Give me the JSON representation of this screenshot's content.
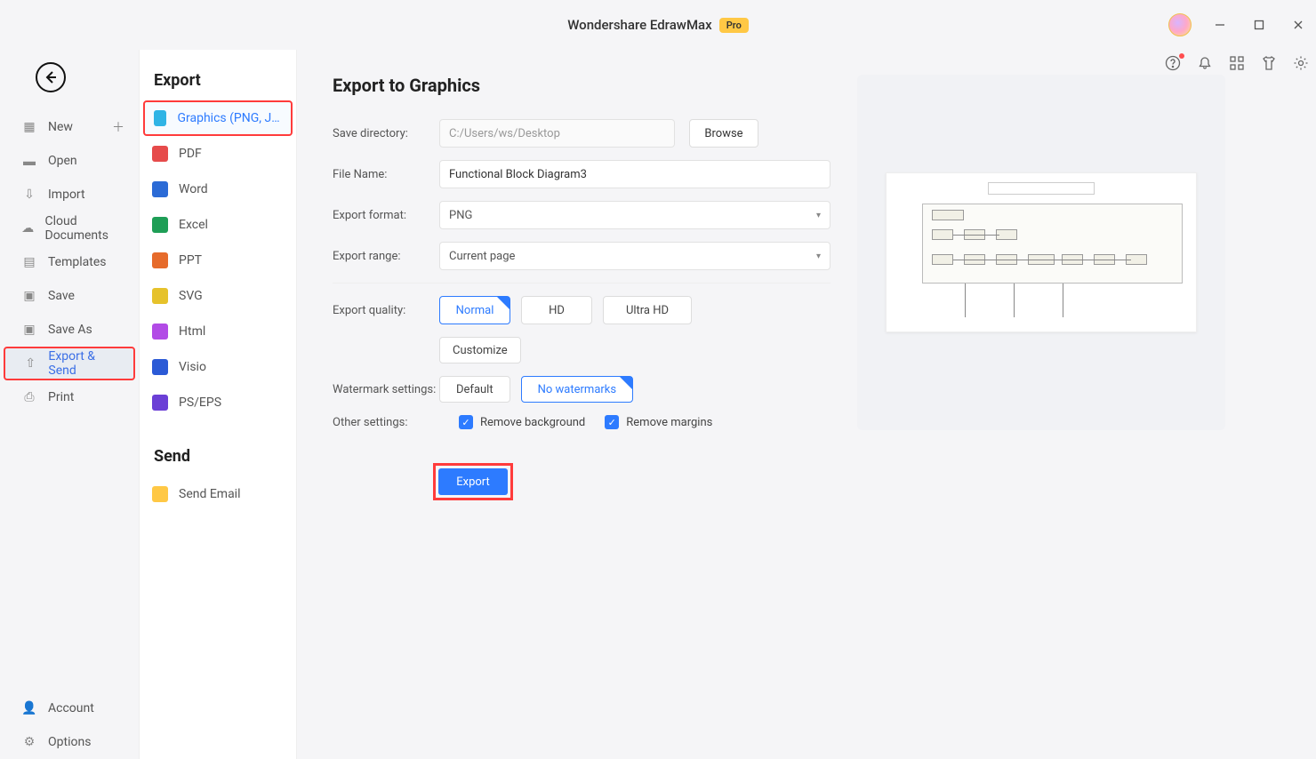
{
  "app": {
    "title": "Wondershare EdrawMax",
    "badge": "Pro"
  },
  "sidebar": {
    "items": [
      {
        "label": "New"
      },
      {
        "label": "Open"
      },
      {
        "label": "Import"
      },
      {
        "label": "Cloud Documents"
      },
      {
        "label": "Templates"
      },
      {
        "label": "Save"
      },
      {
        "label": "Save As"
      },
      {
        "label": "Export & Send"
      },
      {
        "label": "Print"
      }
    ],
    "account": "Account",
    "options": "Options"
  },
  "export_list": {
    "heading": "Export",
    "items": [
      {
        "label": "Graphics (PNG, JPG e...",
        "color": "#30b4e5"
      },
      {
        "label": "PDF",
        "color": "#e64b4b"
      },
      {
        "label": "Word",
        "color": "#2b6bd6"
      },
      {
        "label": "Excel",
        "color": "#1e9e56"
      },
      {
        "label": "PPT",
        "color": "#e66b2b"
      },
      {
        "label": "SVG",
        "color": "#e6c22b"
      },
      {
        "label": "Html",
        "color": "#b24be6"
      },
      {
        "label": "Visio",
        "color": "#2b5ad6"
      },
      {
        "label": "PS/EPS",
        "color": "#6b3fd6"
      }
    ],
    "send_heading": "Send",
    "send": "Send Email"
  },
  "form": {
    "heading": "Export to Graphics",
    "save_dir_label": "Save directory:",
    "save_dir": "C:/Users/ws/Desktop",
    "browse": "Browse",
    "file_name_label": "File Name:",
    "file_name": "Functional Block Diagram3",
    "format_label": "Export format:",
    "format": "PNG",
    "range_label": "Export range:",
    "range": "Current page",
    "quality_label": "Export quality:",
    "quality": [
      "Normal",
      "HD",
      "Ultra HD"
    ],
    "customize": "Customize",
    "wm_label": "Watermark settings:",
    "wm": [
      "Default",
      "No watermarks"
    ],
    "other_label": "Other settings:",
    "remove_bg": "Remove background",
    "remove_margins": "Remove margins",
    "export": "Export"
  }
}
